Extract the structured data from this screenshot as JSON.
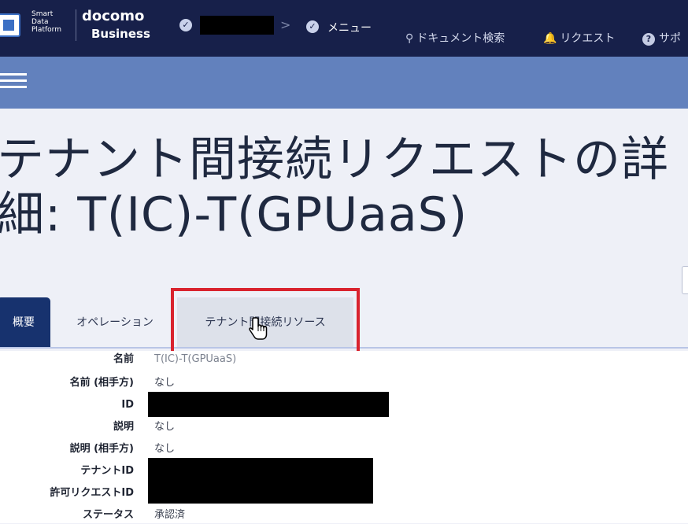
{
  "header": {
    "brand_sdp_lines": "Smart\nData\nPlatform",
    "docomo_top": "docomo",
    "docomo_bottom": "Business",
    "menu_label": "メニュー",
    "nav": {
      "search_label": "ドキュメント検索",
      "request_label": "リクエスト",
      "support_label": "サポ"
    }
  },
  "page": {
    "title": "テナント間接続リクエストの詳\n細: T(IC)-T(GPUaaS)"
  },
  "tabs": [
    {
      "label": "概要",
      "state": "active"
    },
    {
      "label": "オペレーション",
      "state": "normal"
    },
    {
      "label": "テナント間接続リソース",
      "state": "hover"
    }
  ],
  "details": [
    {
      "label": "名前",
      "value": "T(IC)-T(GPUaaS)"
    },
    {
      "label": "名前 (相手方)",
      "value": "なし"
    },
    {
      "label": "ID",
      "value": ""
    },
    {
      "label": "説明",
      "value": "なし"
    },
    {
      "label": "説明 (相手方)",
      "value": "なし"
    },
    {
      "label": "テナントID",
      "value": ""
    },
    {
      "label": "許可リクエストID",
      "value": ""
    },
    {
      "label": "ステータス",
      "value": "承認済"
    }
  ],
  "colors": {
    "topbar": "#17204a",
    "subbar": "#6281bd",
    "active_tab": "#17326e",
    "highlight_box": "#d9232e"
  },
  "icons": [
    "check-circle-icon",
    "search-icon",
    "bell-icon",
    "help-icon",
    "hamburger-icon",
    "pointer-cursor-icon"
  ]
}
